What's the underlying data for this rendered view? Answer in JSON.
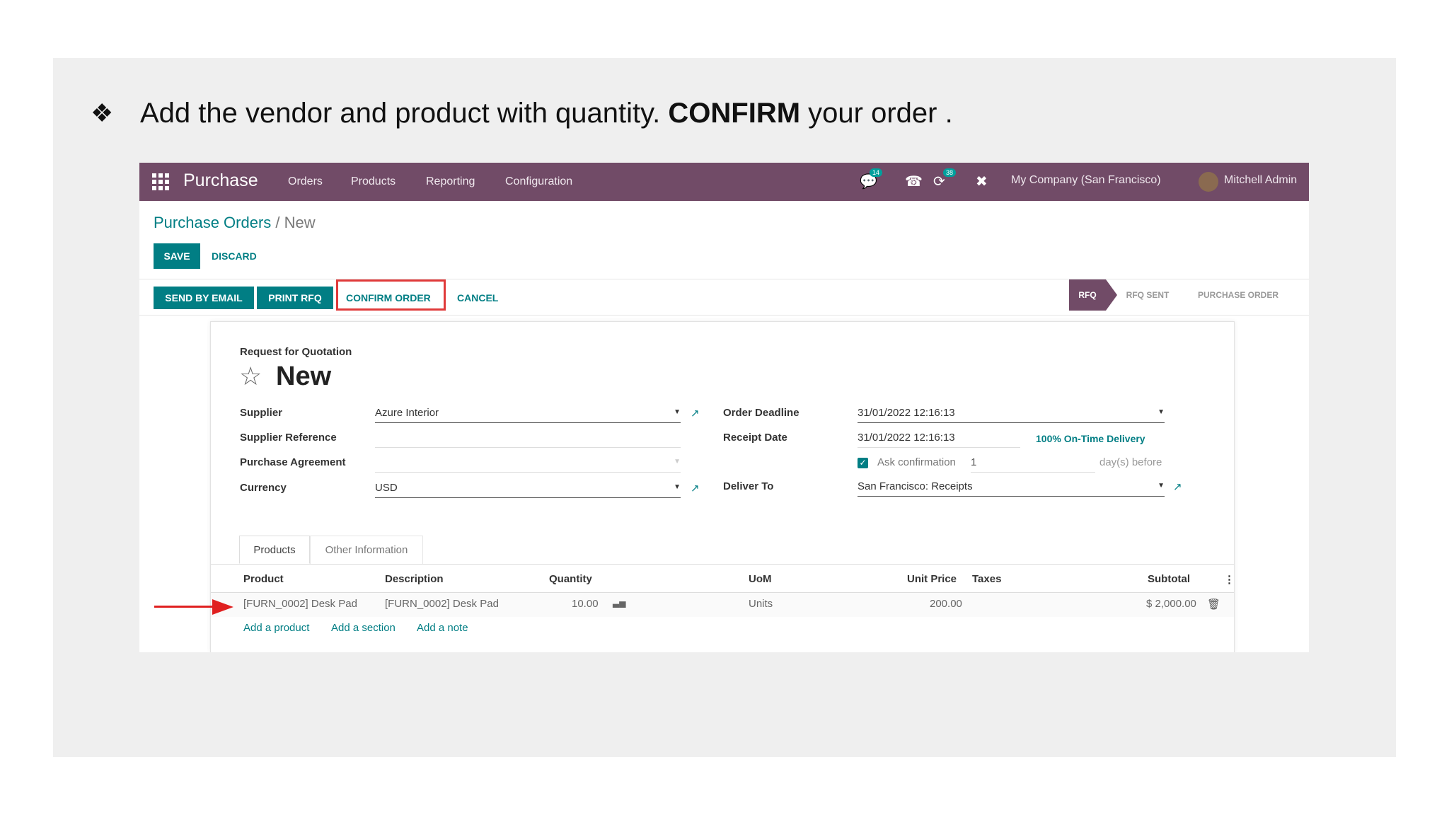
{
  "slide": {
    "bullet": "❖",
    "instruction_pre": "Add the vendor and product with quantity. ",
    "instruction_bold": "CONFIRM",
    "instruction_post": " your order ."
  },
  "navbar": {
    "app_name": "Purchase",
    "menu": [
      "Orders",
      "Products",
      "Reporting",
      "Configuration"
    ],
    "chat_badge": "14",
    "activity_badge": "38",
    "company": "My Company (San Francisco)",
    "user": "Mitchell Admin",
    "colors": {
      "brand": "#714B67",
      "accent": "#017e84"
    }
  },
  "breadcrumb": {
    "parent": "Purchase Orders",
    "separator": " / ",
    "current": "New"
  },
  "control": {
    "save": "SAVE",
    "discard": "DISCARD"
  },
  "statusbar": {
    "send_email": "SEND BY EMAIL",
    "print_rfq": "PRINT RFQ",
    "confirm_order": "CONFIRM ORDER",
    "cancel": "CANCEL",
    "stages": [
      "RFQ",
      "RFQ SENT",
      "PURCHASE ORDER"
    ],
    "active_stage": "RFQ"
  },
  "form": {
    "title_label": "Request for Quotation",
    "name": "New",
    "left": {
      "supplier_label": "Supplier",
      "supplier_value": "Azure Interior",
      "supplier_ref_label": "Supplier Reference",
      "supplier_ref_value": "",
      "agreement_label": "Purchase Agreement",
      "agreement_value": "",
      "currency_label": "Currency",
      "currency_value": "USD"
    },
    "right": {
      "deadline_label": "Order Deadline",
      "deadline_value": "31/01/2022 12:16:13",
      "receipt_label": "Receipt Date",
      "receipt_value": "31/01/2022 12:16:13",
      "on_time": "100% On-Time Delivery",
      "ask_confirmation": "Ask confirmation",
      "ask_days": "1",
      "days_before": "day(s) before",
      "deliver_label": "Deliver To",
      "deliver_value": "San Francisco: Receipts"
    }
  },
  "tabs": [
    "Products",
    "Other Information"
  ],
  "table": {
    "headers": {
      "product": "Product",
      "description": "Description",
      "quantity": "Quantity",
      "uom": "UoM",
      "unit_price": "Unit Price",
      "taxes": "Taxes",
      "subtotal": "Subtotal"
    },
    "rows": [
      {
        "product": "[FURN_0002] Desk Pad",
        "description": "[FURN_0002] Desk Pad",
        "quantity": "10.00",
        "uom": "Units",
        "unit_price": "200.00",
        "taxes": "",
        "subtotal": "$ 2,000.00"
      }
    ],
    "add_product": "Add a product",
    "add_section": "Add a section",
    "add_note": "Add a note"
  }
}
